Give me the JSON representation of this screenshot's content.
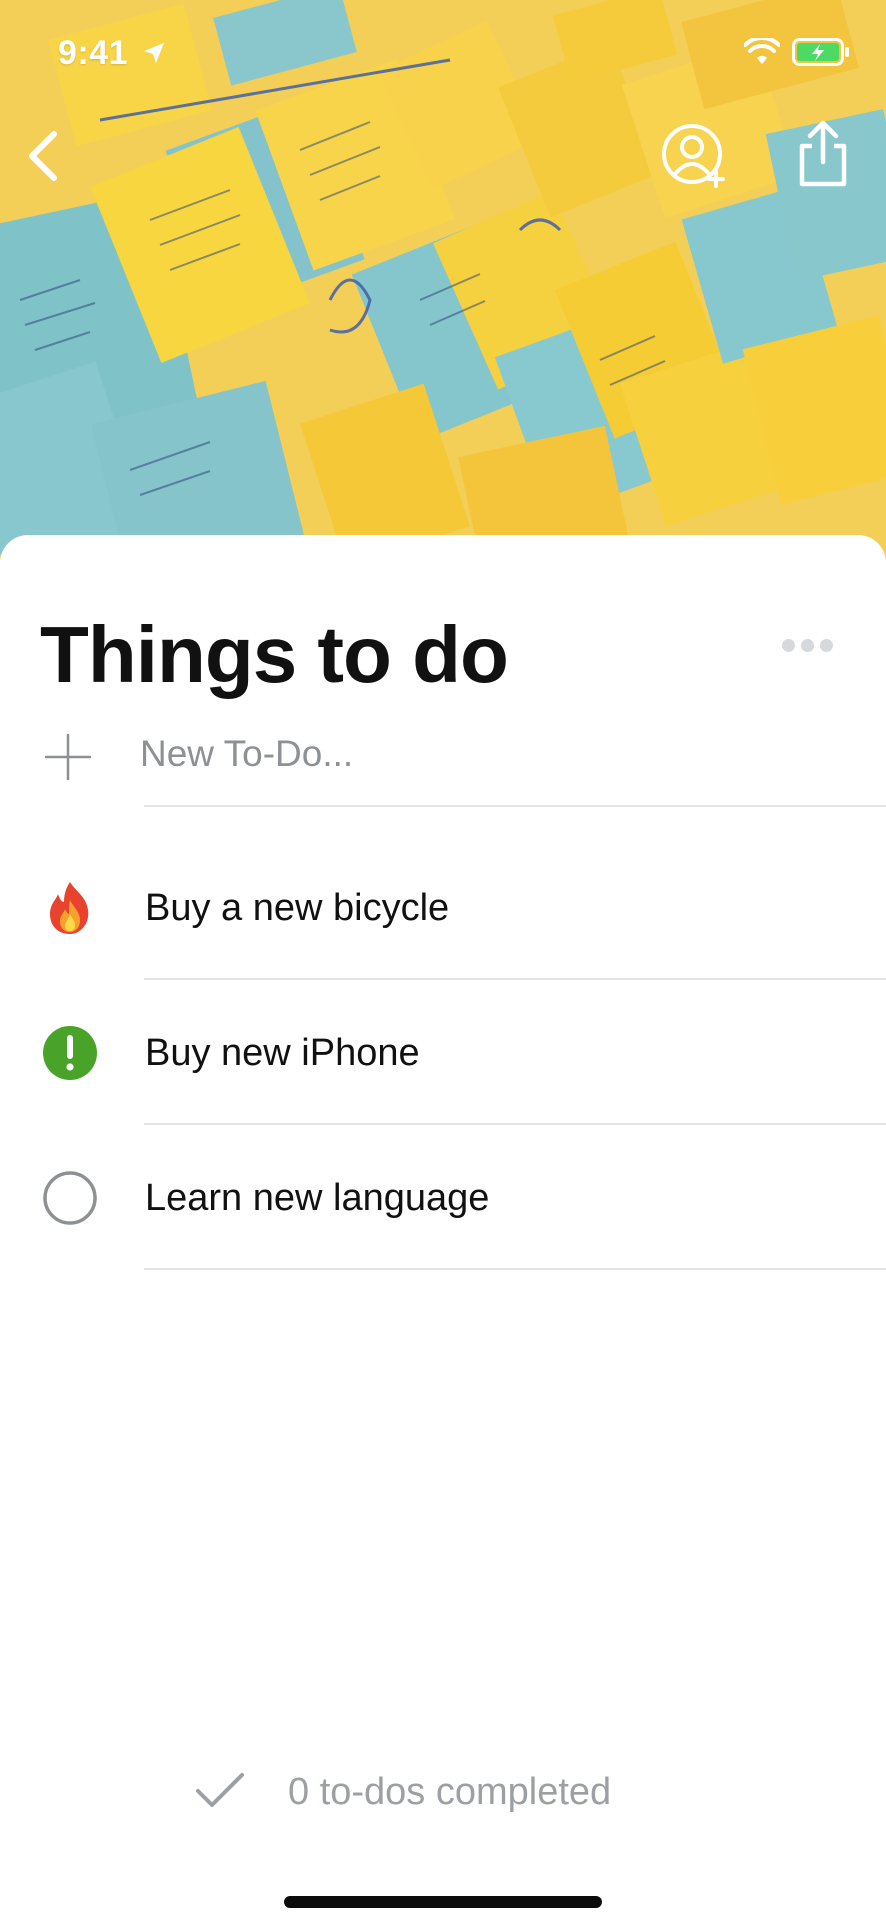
{
  "status_bar": {
    "time": "9:41"
  },
  "header": {
    "title": "Things to do"
  },
  "new_todo": {
    "placeholder": "New To-Do..."
  },
  "todos": [
    {
      "label": "Buy a new bicycle",
      "icon": "fire-icon"
    },
    {
      "label": "Buy new iPhone",
      "icon": "exclamation-icon"
    },
    {
      "label": "Learn new language",
      "icon": "empty-circle-icon"
    }
  ],
  "footer": {
    "completed_label": "0 to-dos completed"
  },
  "colors": {
    "accent_green": "#4aa329",
    "divider": "#e3e4e6",
    "muted_text": "#9ca0a4"
  }
}
